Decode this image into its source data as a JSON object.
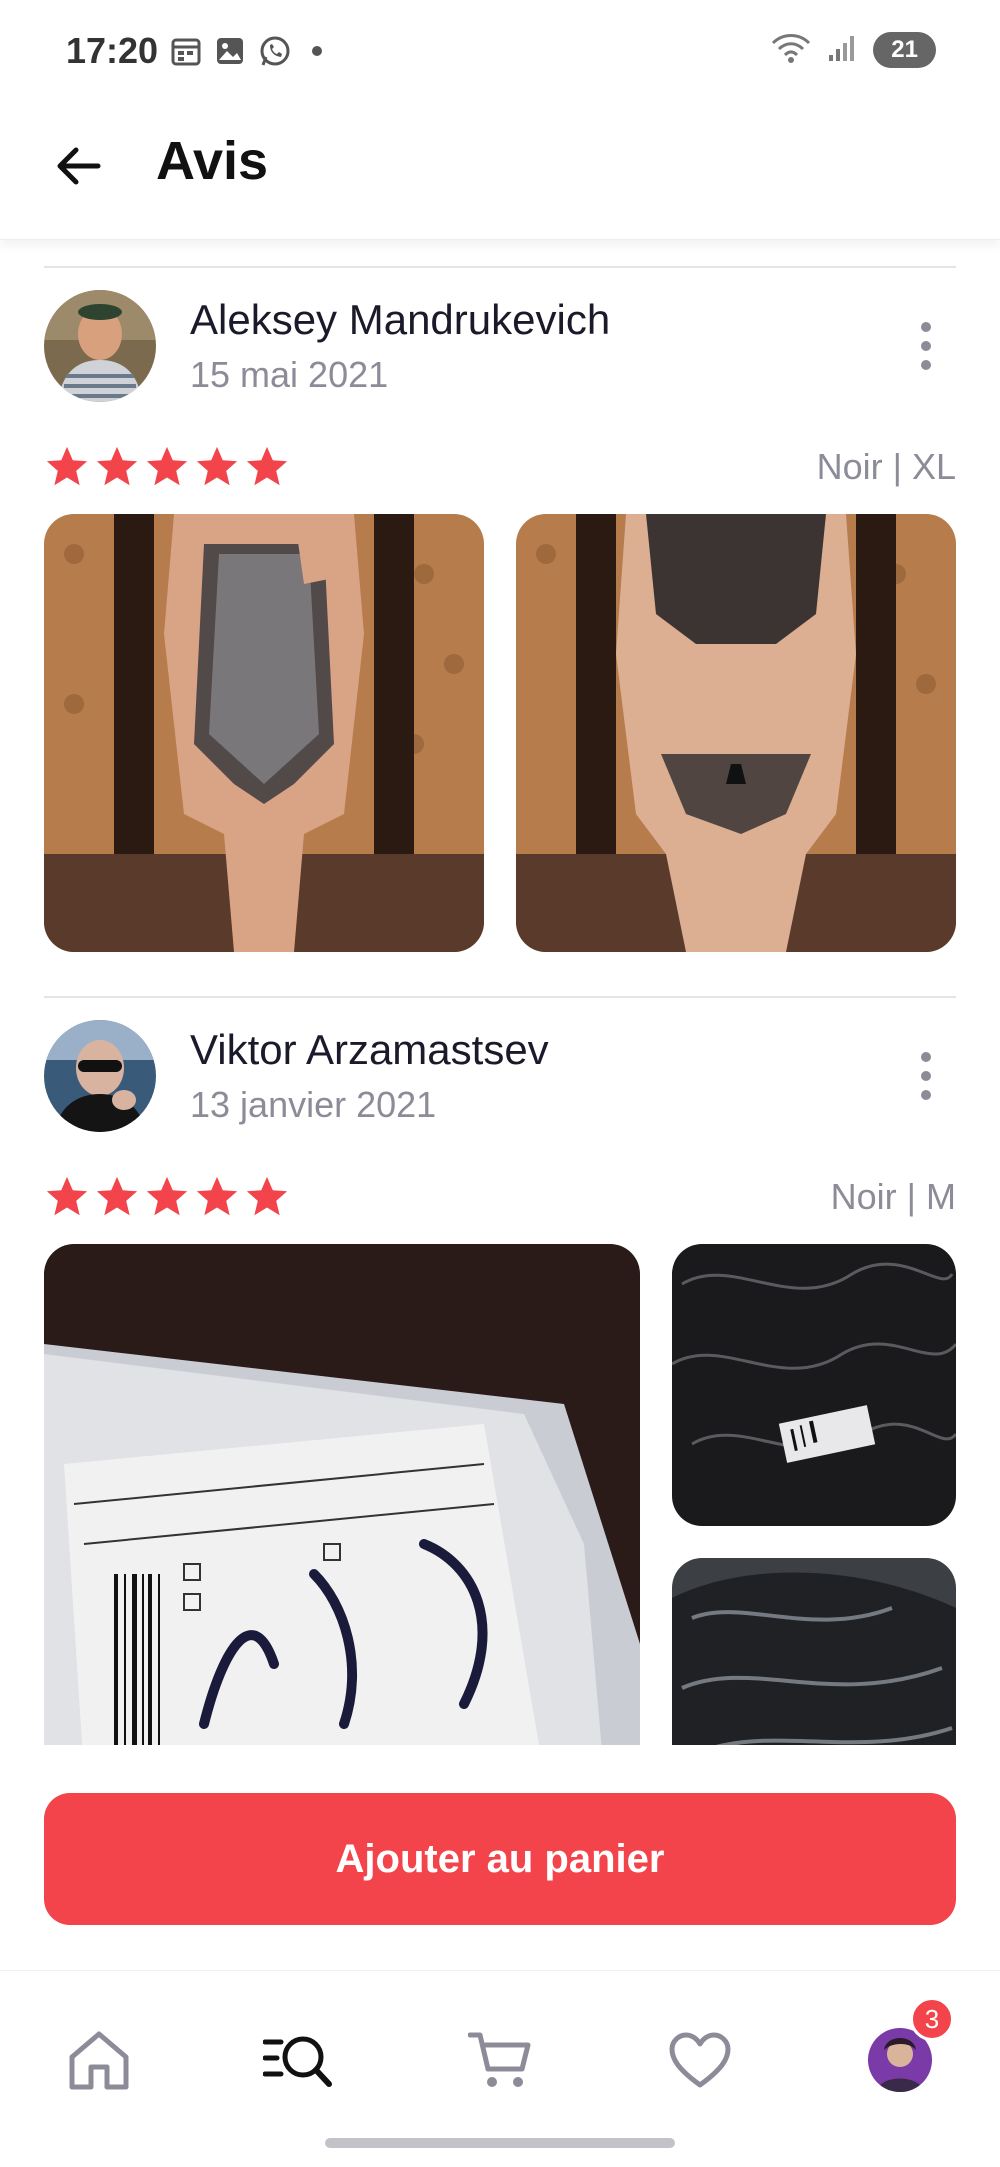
{
  "status_bar": {
    "time": "17:20",
    "battery": "21",
    "icons": [
      "calendar-icon",
      "gallery-icon",
      "whatsapp-icon",
      "notification-dot",
      "wifi-icon",
      "signal-icon",
      "battery-icon"
    ]
  },
  "header": {
    "title": "Avis",
    "back_icon": "arrow-left-icon"
  },
  "reviews": [
    {
      "name": "Aleksey Mandrukevich",
      "date": "15 mai 2021",
      "rating": 5,
      "variant": "Noir | XL",
      "photo_count": 2
    },
    {
      "name": "Viktor Arzamastsev",
      "date": "13 janvier 2021",
      "rating": 5,
      "variant": "Noir | M",
      "photo_count": 3
    }
  ],
  "cart_button": {
    "label": "Ajouter au panier"
  },
  "bottom_nav": {
    "items": [
      "home-icon",
      "search-list-icon",
      "cart-icon",
      "heart-icon",
      "profile-avatar"
    ],
    "profile_badge": "3"
  },
  "colors": {
    "accent": "#f2444a",
    "star": "#f2444a",
    "muted_text": "#8c8c99"
  }
}
